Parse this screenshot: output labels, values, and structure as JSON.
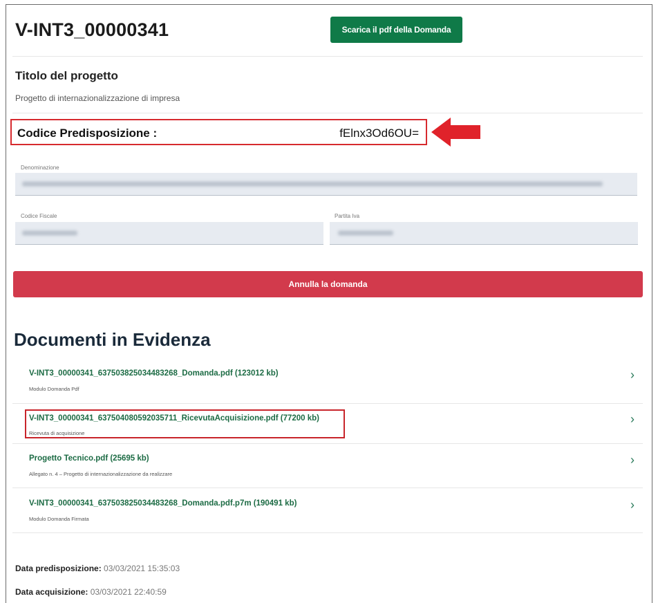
{
  "header": {
    "title": "V-INT3_00000341",
    "download_button": "Scarica il pdf della Domanda"
  },
  "project": {
    "title_label": "Titolo del progetto",
    "title_value": "Progetto di internazionalizzazione di impresa"
  },
  "code": {
    "label": "Codice Predisposizione :",
    "value": "fElnx3Od6OU="
  },
  "fields": {
    "denominazione_label": "Denominazione",
    "codice_fiscale_label": "Codice Fiscale",
    "partita_iva_label": "Partita Iva"
  },
  "cancel_button": "Annulla la domanda",
  "documents": {
    "heading": "Documenti in Evidenza",
    "items": [
      {
        "link": "V-INT3_00000341_637503825034483268_Domanda.pdf (123012 kb)",
        "sub": "Modulo Domanda Pdf"
      },
      {
        "link": "V-INT3_00000341_637504080592035711_RicevutaAcquisizione.pdf (77200 kb)",
        "sub": "Ricevuta di acquisizione"
      },
      {
        "link": "Progetto Tecnico.pdf (25695 kb)",
        "sub": "Allegato n. 4 – Progetto di internazionalizzazione da realizzare"
      },
      {
        "link": "V-INT3_00000341_637503825034483268_Domanda.pdf.p7m (190491 kb)",
        "sub": "Modulo Domanda Firmata"
      }
    ]
  },
  "meta": {
    "predisposizione_label": "Data predisposizione:",
    "predisposizione_value": "03/03/2021 15:35:03",
    "acquisizione_label": "Data acquisizione:",
    "acquisizione_value": "03/03/2021 22:40:59"
  },
  "colors": {
    "primary_green": "#0f7a48",
    "danger_red": "#d23a4c",
    "highlight_red": "#d62a2e",
    "link_green": "#1c6b44"
  }
}
